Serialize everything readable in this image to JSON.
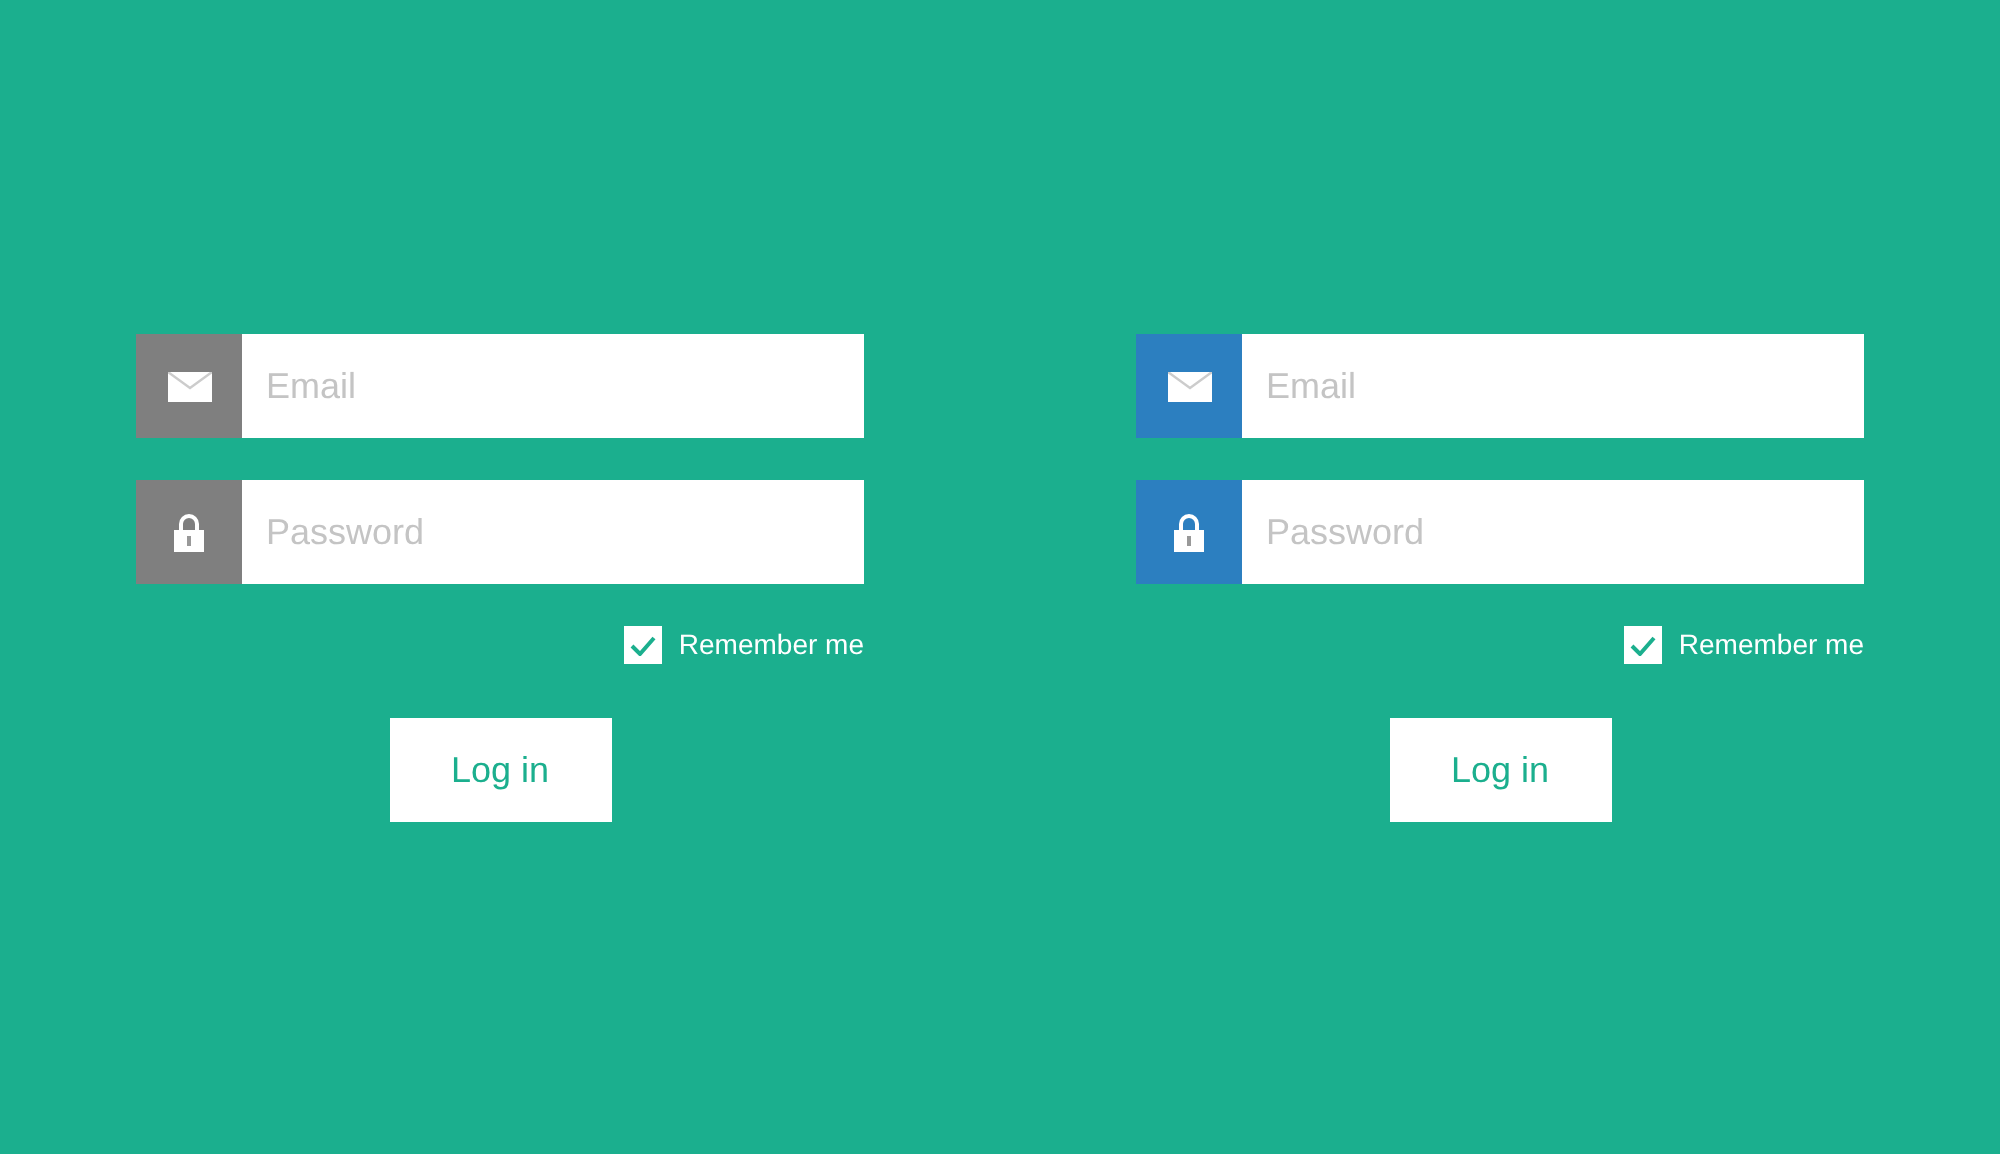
{
  "forms": [
    {
      "color": "#7f7f7f",
      "fields": [
        {
          "kind": "email",
          "placeholder": "Email"
        },
        {
          "kind": "password",
          "placeholder": "Password"
        }
      ],
      "remember": {
        "label": "Remember me",
        "checked": true
      },
      "button": "Log in"
    },
    {
      "color": "#2c7fc0",
      "fields": [
        {
          "kind": "email",
          "placeholder": "Email"
        },
        {
          "kind": "password",
          "placeholder": "Password"
        }
      ],
      "remember": {
        "label": "Remember me",
        "checked": true
      },
      "button": "Log in"
    }
  ]
}
